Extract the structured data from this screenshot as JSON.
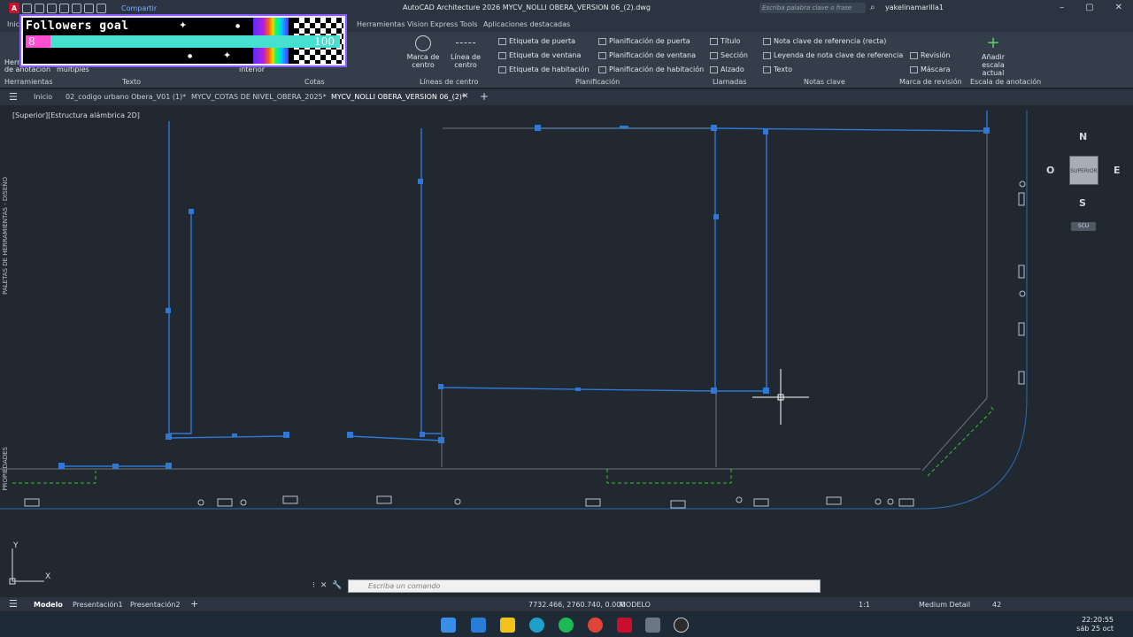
{
  "titlebar": {
    "share_label": "Compartir",
    "title": "AutoCAD Architecture 2026    MYCV_NOLLI OBERA_VERSION 06_(2).dwg",
    "search_placeholder": "Escriba palabra clave o frase",
    "user": "yakelinamarilla1",
    "logo_text": "A"
  },
  "ribbon_tabs": [
    {
      "label": "Inici"
    },
    {
      "label": "Herramientas Vision"
    },
    {
      "label": "Express Tools"
    },
    {
      "label": "Aplicaciones destacadas"
    }
  ],
  "followers_widget": {
    "title": "Followers goal",
    "current": "8",
    "goal": "100",
    "progress": 0.08
  },
  "ribbon": {
    "left_labels": {
      "herr": "Herr",
      "de_anotacion": "de anotación",
      "multiples": "múltiples",
      "interior": "interior"
    },
    "center_mark_button": "Marca de centro",
    "center_line_button": "Línea de centro",
    "door_tag": "Etiqueta de puerta",
    "window_tag": "Etiqueta de ventana",
    "room_tag": "Etiqueta de habitación",
    "door_schedule": "Planificación de puerta",
    "window_schedule": "Planificación de ventana",
    "room_schedule": "Planificación de habitación",
    "title_label": "Título",
    "section_label": "Sección",
    "elevation_label": "Alzado",
    "text_label": "Texto",
    "keynote_straight": "Nota clave de referencia (recta)",
    "keynote_legend": "Leyenda de nota clave de referencia",
    "revision": "Revisión",
    "mask": "Máscara",
    "add_scale": "Añadir escala actual",
    "groups": {
      "herramientas": "Herramientas",
      "texto": "Texto",
      "cotas": "Cotas",
      "lineas_centro": "Líneas de centro",
      "planificacion": "Planificación",
      "llamadas": "Llamadas",
      "notas_clave": "Notas clave",
      "marca_revision": "Marca de revisión",
      "escala_anotacion": "Escala de anotación"
    }
  },
  "doc_tabs": [
    {
      "label": "Inicio"
    },
    {
      "label": "02_codigo urbano Obera_V01 (1)*"
    },
    {
      "label": "MYCV_COTAS DE NIVEL_OBERA_2025*"
    },
    {
      "label": "MYCV_NOLLI OBERA_VERSION 06_(2)*"
    }
  ],
  "viewport": {
    "label": "[Superior][Estructura alámbrica 2D]",
    "palette_label": "PALETAS DE HERRAMIENTAS - DISEÑO",
    "properties_label": "PROPIEDADES"
  },
  "viewcube": {
    "north": "N",
    "south": "S",
    "east": "E",
    "west": "O",
    "face": "SUPERIOR",
    "wcs": "SCU"
  },
  "ucs_icon": {
    "y": "Y",
    "x": "X"
  },
  "command_line": {
    "placeholder": "Escriba un comando"
  },
  "status_bar": {
    "model_tab": "Modelo",
    "layout1": "Presentación1",
    "layout2": "Presentación2",
    "coords": "7732.466, 2760.740, 0.000",
    "space": "MODELO",
    "scale": "1:1",
    "detail": "Medium Detail",
    "value": "42"
  },
  "taskbar": {
    "time": "22:20:55",
    "date": "sáb 25 oct"
  },
  "colors": {
    "accent": "#3b82d6",
    "entity_line": "#2f78d6",
    "hatch_green": "#39c52a",
    "background": "#212830"
  }
}
